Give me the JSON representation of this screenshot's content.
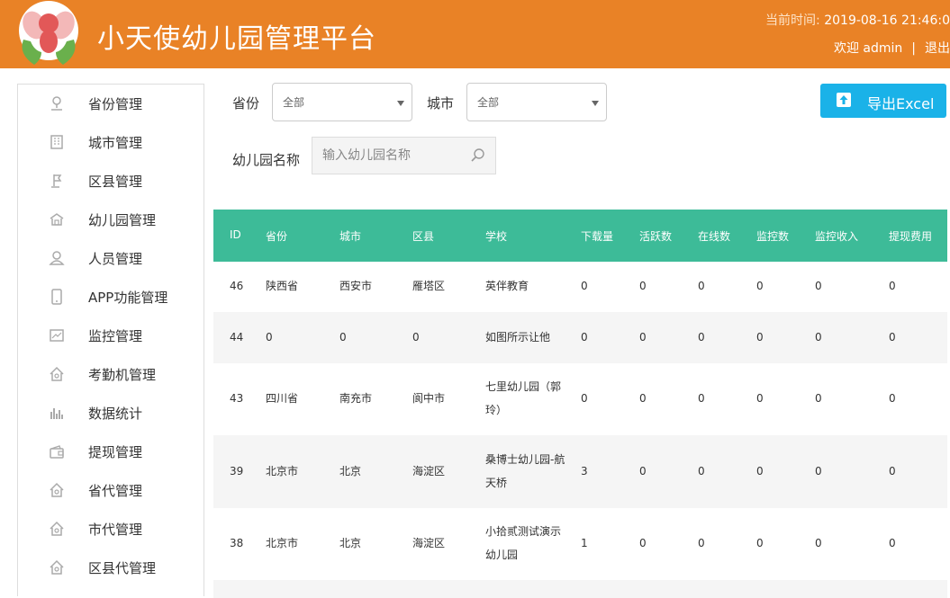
{
  "header": {
    "title": "小天使幼儿园管理平台",
    "time_label": "当前时间: ",
    "time_value": "2019-08-16 21:46:0",
    "welcome": "欢迎 admin",
    "separator": "|",
    "logout": "退出"
  },
  "sidebar": {
    "items": [
      {
        "label": "省份管理",
        "icon": "map-pin-icon"
      },
      {
        "label": "城市管理",
        "icon": "building-icon"
      },
      {
        "label": "区县管理",
        "icon": "flag-icon"
      },
      {
        "label": "幼儿园管理",
        "icon": "school-icon"
      },
      {
        "label": "人员管理",
        "icon": "person-icon"
      },
      {
        "label": "APP功能管理",
        "icon": "phone-icon"
      },
      {
        "label": "监控管理",
        "icon": "monitor-icon"
      },
      {
        "label": "考勤机管理",
        "icon": "house-icon"
      },
      {
        "label": "数据统计",
        "icon": "bar-chart-icon"
      },
      {
        "label": "提现管理",
        "icon": "wallet-icon"
      },
      {
        "label": "省代管理",
        "icon": "house-icon"
      },
      {
        "label": "市代管理",
        "icon": "house-icon"
      },
      {
        "label": "区县代管理",
        "icon": "house-icon"
      }
    ]
  },
  "filters": {
    "province_label": "省份",
    "province_value": "全部",
    "city_label": "城市",
    "city_value": "全部",
    "school_label": "幼儿园名称",
    "school_placeholder": "输入幼儿园名称"
  },
  "export_label": "导出Excel",
  "table": {
    "headers": [
      "ID",
      "省份",
      "城市",
      "区县",
      "学校",
      "下载量",
      "活跃数",
      "在线数",
      "监控数",
      "监控收入",
      "提现费用"
    ],
    "rows": [
      {
        "cells": [
          "46",
          "陕西省",
          "西安市",
          "雁塔区",
          "英伴教育",
          "0",
          "0",
          "0",
          "0",
          "0",
          "0"
        ]
      },
      {
        "cells": [
          "44",
          "0",
          "0",
          "0",
          "如图所示让他",
          "0",
          "0",
          "0",
          "0",
          "0",
          "0"
        ]
      },
      {
        "cells": [
          "43",
          "四川省",
          "南充市",
          "阆中市",
          "七里幼儿园（郭玲）",
          "0",
          "0",
          "0",
          "0",
          "0",
          "0"
        ]
      },
      {
        "cells": [
          "39",
          "北京市",
          "北京",
          "海淀区",
          "桑博士幼儿园-航天桥",
          "3",
          "0",
          "0",
          "0",
          "0",
          "0"
        ]
      },
      {
        "cells": [
          "38",
          "北京市",
          "北京",
          "海淀区",
          "小拾贰测试演示幼儿园",
          "1",
          "0",
          "0",
          "0",
          "0",
          "0"
        ]
      }
    ]
  }
}
